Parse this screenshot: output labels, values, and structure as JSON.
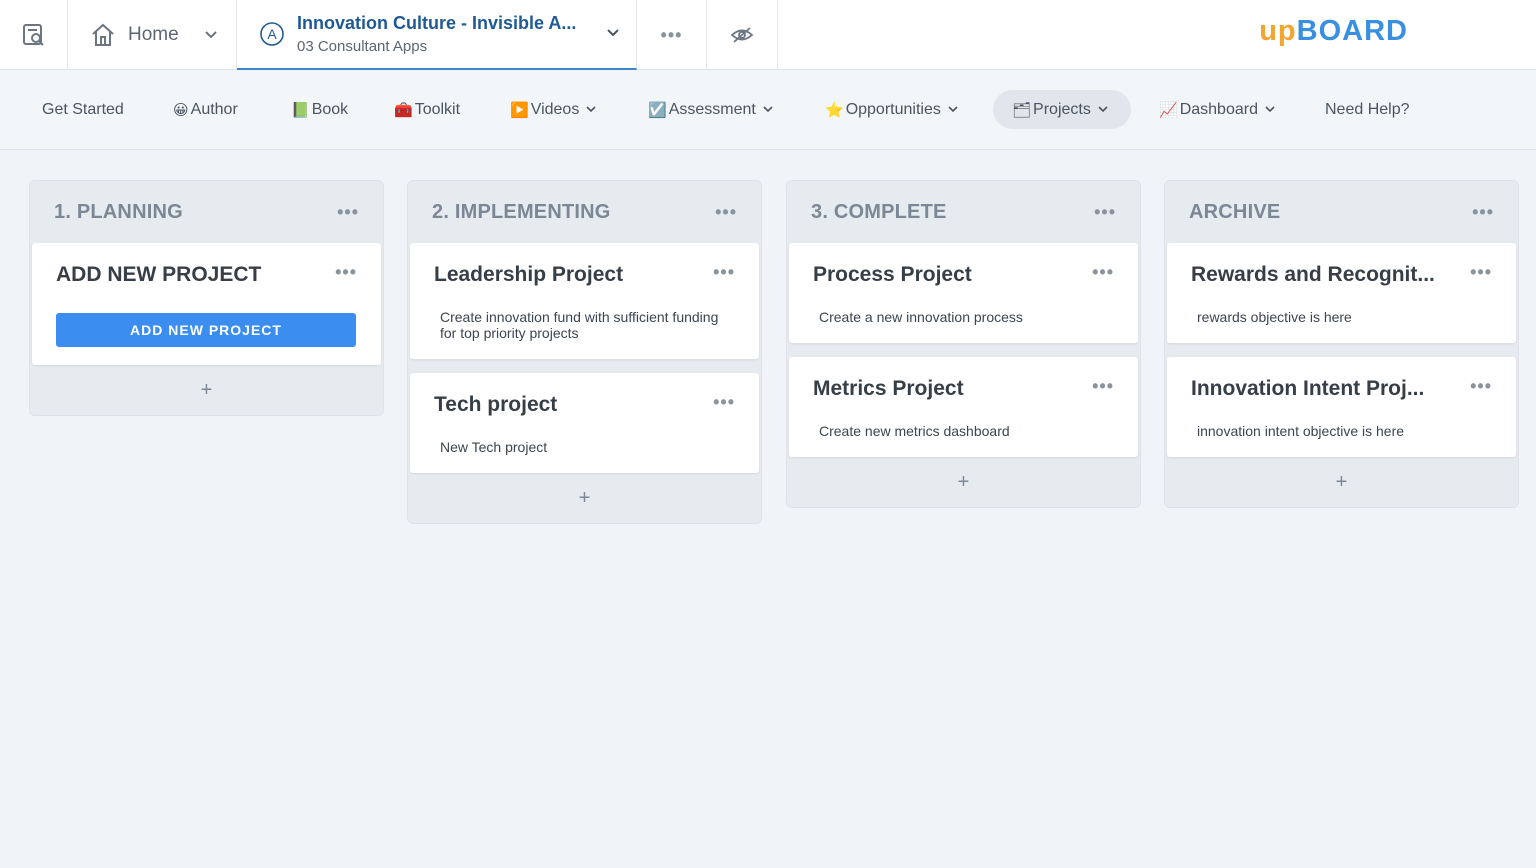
{
  "topbar": {
    "home_label": "Home",
    "app_title": "Innovation Culture - Invisible A...",
    "app_subtitle": "03 Consultant Apps",
    "app_badge": "A",
    "brand_up": "up",
    "brand_board": "BOARD"
  },
  "nav": {
    "items": [
      {
        "label": "Get Started",
        "emoji": "",
        "has_caret": false
      },
      {
        "label": "Author",
        "emoji": "😀",
        "has_caret": false
      },
      {
        "label": "Book",
        "emoji": "📗",
        "has_caret": false
      },
      {
        "label": "Toolkit",
        "emoji": "🧰",
        "has_caret": false
      },
      {
        "label": "Videos",
        "emoji": "▶️",
        "has_caret": true
      },
      {
        "label": "Assessment",
        "emoji": "☑️",
        "has_caret": true
      },
      {
        "label": "Opportunities",
        "emoji": "⭐",
        "has_caret": true
      },
      {
        "label": "Projects",
        "emoji": "🗂",
        "has_caret": true,
        "active": true
      },
      {
        "label": "Dashboard",
        "emoji": "📈",
        "has_caret": true
      },
      {
        "label": "Need Help?",
        "emoji": "",
        "has_caret": false
      }
    ]
  },
  "board": {
    "columns": [
      {
        "title": "1. PLANNING",
        "cards": [
          {
            "title": "ADD NEW PROJECT",
            "button": "ADD NEW PROJECT"
          }
        ]
      },
      {
        "title": "2. IMPLEMENTING",
        "cards": [
          {
            "title": "Leadership Project",
            "desc": "Create innovation fund with sufficient funding for top priority projects"
          },
          {
            "title": "Tech project",
            "desc": "New Tech project"
          }
        ]
      },
      {
        "title": "3. COMPLETE",
        "cards": [
          {
            "title": "Process Project",
            "desc": "Create a new innovation process"
          },
          {
            "title": "Metrics Project",
            "desc": "Create new metrics dashboard"
          }
        ]
      },
      {
        "title": "ARCHIVE",
        "cards": [
          {
            "title": "Rewards and Recognit...",
            "desc": "rewards objective is here"
          },
          {
            "title": "Innovation Intent Proj...",
            "desc": "innovation intent objective is here"
          }
        ]
      }
    ],
    "more_glyph": "•••",
    "add_glyph": "+"
  },
  "colors": {
    "accent": "#3b8ef0",
    "brand_orange": "#f2a530",
    "brand_blue": "#3a90e0",
    "background": "#f0f4f8"
  },
  "icons": [
    "search-book-icon",
    "home-icon",
    "chevron-down-icon",
    "app-circle-icon",
    "more-icon",
    "eye-off-icon"
  ]
}
